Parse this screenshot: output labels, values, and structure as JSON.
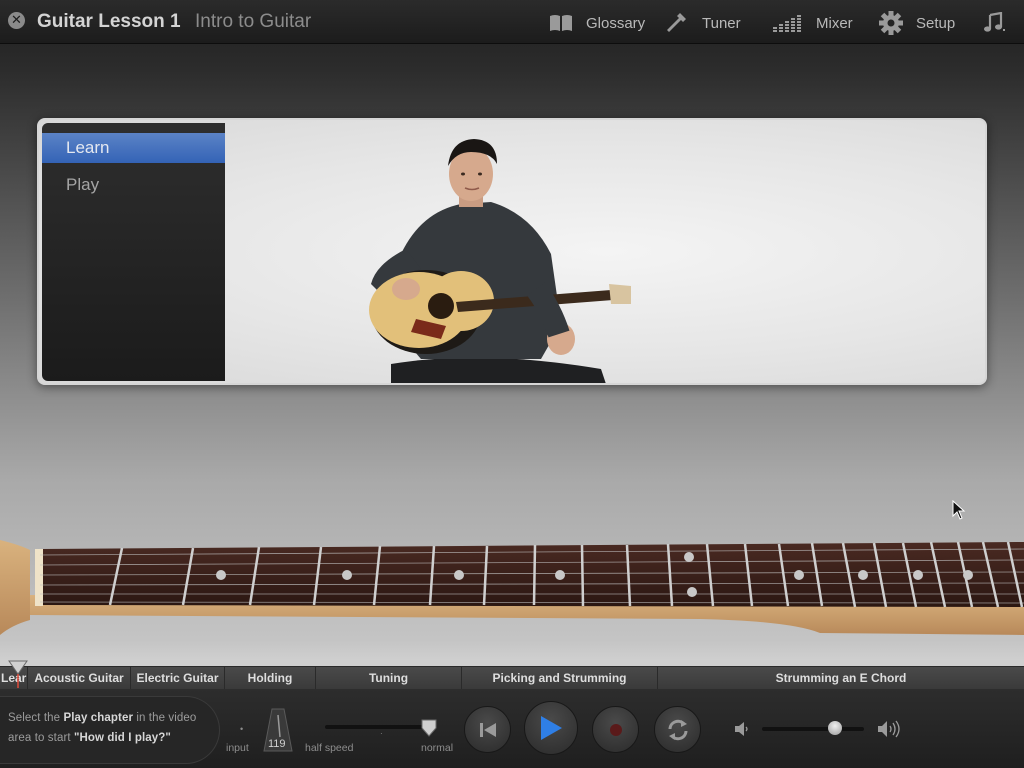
{
  "header": {
    "close_glyph": "✕",
    "title": "Guitar Lesson 1",
    "subtitle": "Intro to Guitar",
    "nav": [
      {
        "label": "Glossary",
        "icon": "book-icon"
      },
      {
        "label": "Tuner",
        "icon": "tuning-fork-icon"
      },
      {
        "label": "Mixer",
        "icon": "mixer-icon"
      },
      {
        "label": "Setup",
        "icon": "gear-icon"
      },
      {
        "label": "",
        "icon": "music-note-icon"
      }
    ]
  },
  "video": {
    "chapters": [
      {
        "label": "Learn",
        "selected": true
      },
      {
        "label": "Play",
        "selected": false
      }
    ]
  },
  "timeline": {
    "segments": [
      "Lear",
      "Acoustic Guitar",
      "Electric Guitar",
      "Holding",
      "Tuning",
      "Picking and Strumming",
      "Strumming an E Chord"
    ]
  },
  "controls": {
    "hint_prefix": "Select the ",
    "hint_bold1": "Play chapter",
    "hint_mid": " in the video area to start ",
    "hint_quote": "\"How did I play?\"",
    "input_label": "input",
    "tempo_value": "119",
    "speed_min_label": "half speed",
    "speed_max_label": "normal",
    "speed_level": 1.0,
    "volume_level": 0.72
  },
  "colors": {
    "accent_blue": "#2f7fe6",
    "selected_chapter": "#3f6cbd",
    "record_red": "#5a1a1a"
  }
}
